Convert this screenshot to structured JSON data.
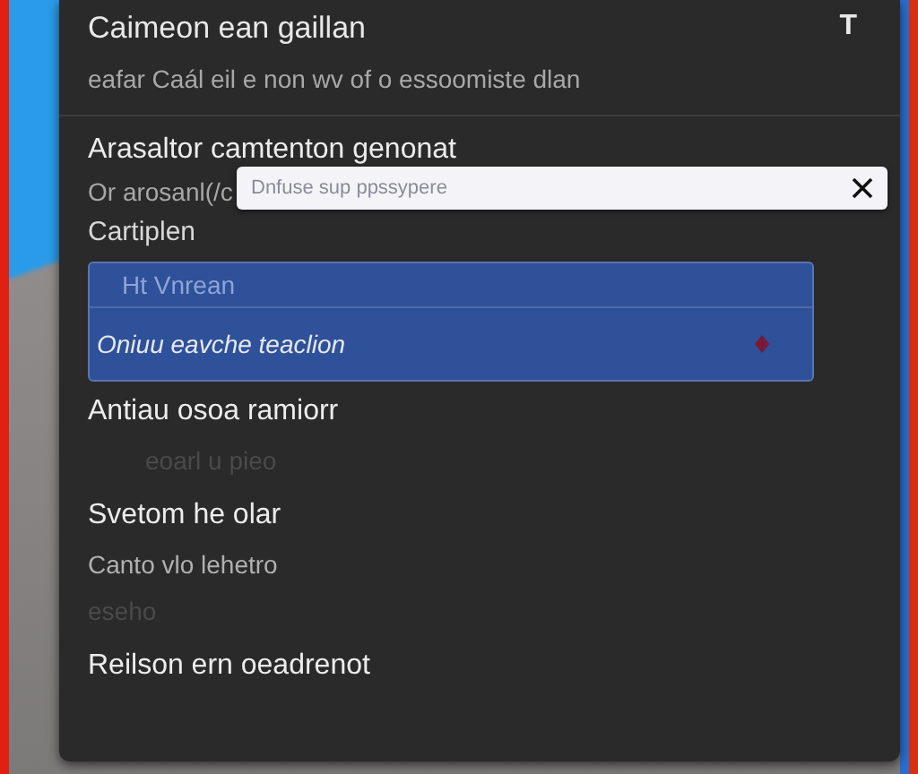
{
  "dialog": {
    "title": "Caimeon ean gaillan",
    "header_button": "T",
    "subtitle": "eafar Caál eil e non wv of o essoomiste dlan"
  },
  "section_title": "Arasaltor camtenton genonat",
  "hint": "Or arosanl(/c",
  "search": {
    "placeholder": "Dnfuse sup ppssypere"
  },
  "field_label": "Cartiplen",
  "dropdown": {
    "options": [
      {
        "label": "Ht Vnrean",
        "selected": false
      },
      {
        "label": "Oniuu eavche teaclion",
        "selected": true
      }
    ]
  },
  "groups": [
    {
      "title": "Antiau osoa ramiorr",
      "lines": [
        {
          "text": "eoarl u pieo",
          "disabled": true
        }
      ]
    },
    {
      "title": "Svetom he olar",
      "lines": [
        {
          "text": "Canto vlo lehetro",
          "disabled": false
        },
        {
          "text": "eseho",
          "disabled": true
        }
      ]
    },
    {
      "title": "Reilson ern oeadrenot"
    }
  ]
}
